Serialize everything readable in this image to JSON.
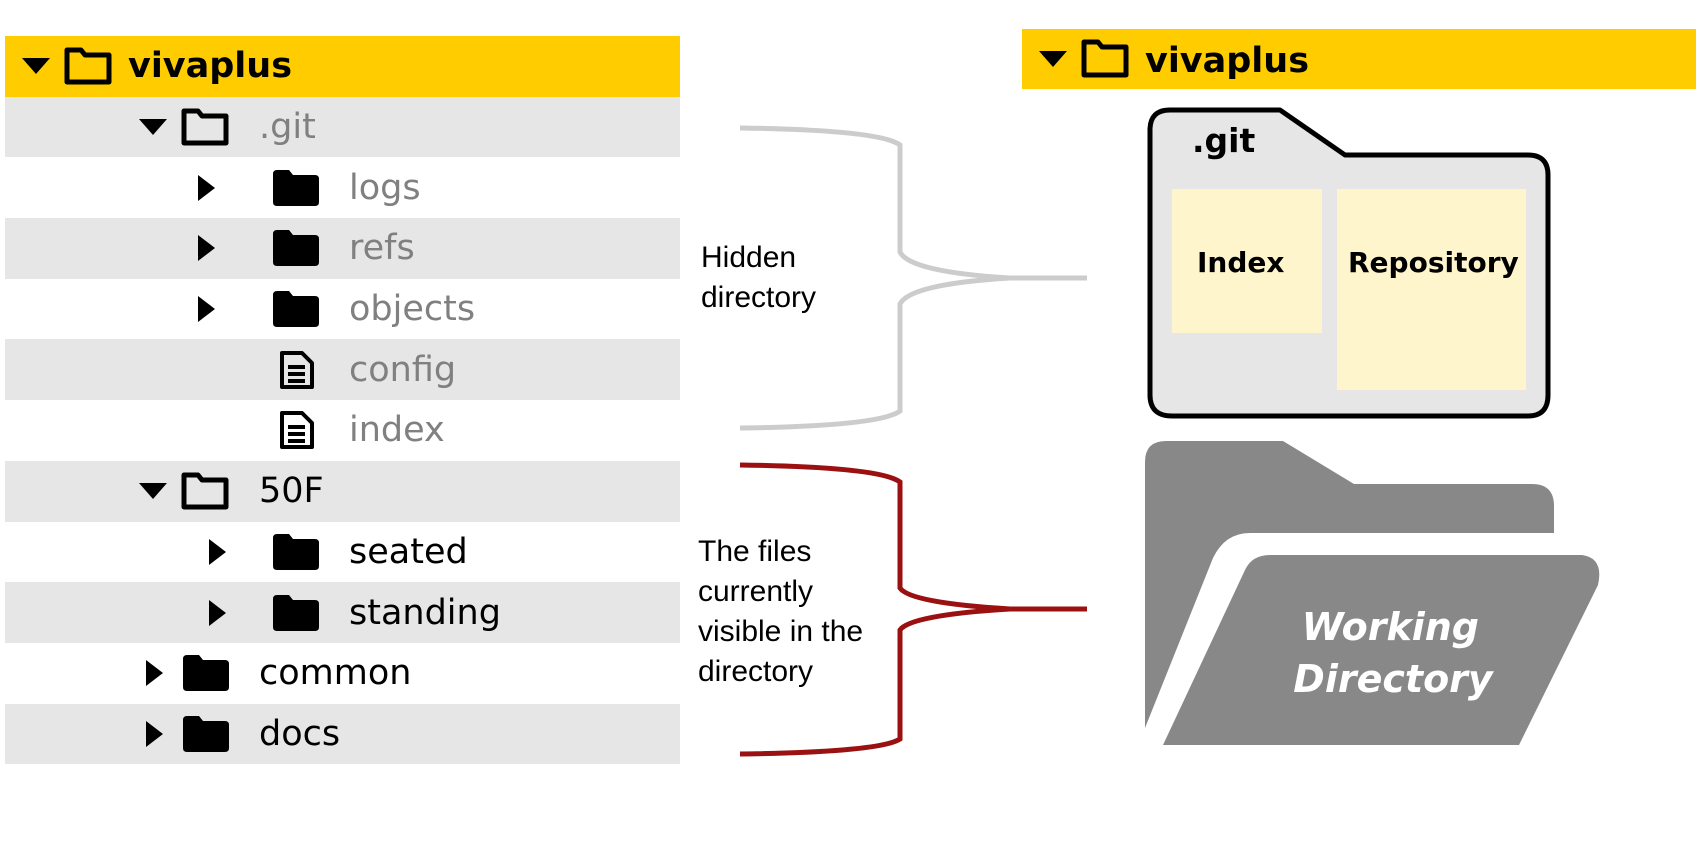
{
  "tree": {
    "root": {
      "label": "vivaplus",
      "icon": "folder-open-icon"
    },
    "items": [
      {
        "label": ".git",
        "icon": "folder-open-icon",
        "expanded": true,
        "hidden": true
      },
      {
        "label": "logs",
        "icon": "folder-icon",
        "expanded": false,
        "hidden": true
      },
      {
        "label": "refs",
        "icon": "folder-icon",
        "expanded": false,
        "hidden": true
      },
      {
        "label": "objects",
        "icon": "folder-icon",
        "expanded": false,
        "hidden": true
      },
      {
        "label": "config",
        "icon": "file-icon",
        "hidden": true
      },
      {
        "label": "index",
        "icon": "file-icon",
        "hidden": true
      },
      {
        "label": "50F",
        "icon": "folder-open-icon",
        "expanded": true
      },
      {
        "label": "seated",
        "icon": "folder-icon",
        "expanded": false
      },
      {
        "label": "standing",
        "icon": "folder-icon",
        "expanded": false
      },
      {
        "label": "common",
        "icon": "folder-icon",
        "expanded": false
      },
      {
        "label": "docs",
        "icon": "folder-icon",
        "expanded": false
      }
    ]
  },
  "annotations": {
    "hidden": [
      "Hidden",
      "directory"
    ],
    "visible": [
      "The files",
      "currently",
      "visible in the",
      "directory"
    ]
  },
  "right": {
    "root_label": "vivaplus",
    "git_label": ".git",
    "index_label": "Index",
    "repository_label": "Repository",
    "working_dir": [
      "Working",
      "Directory"
    ]
  },
  "colors": {
    "header": "#ffcc00",
    "row_alt": "#e6e6e6",
    "hidden_text": "#808080",
    "hidden_brace": "#cccccc",
    "visible_brace": "#9b1010",
    "git_box_fill": "#fff5cc",
    "working_dir": "#888888"
  }
}
